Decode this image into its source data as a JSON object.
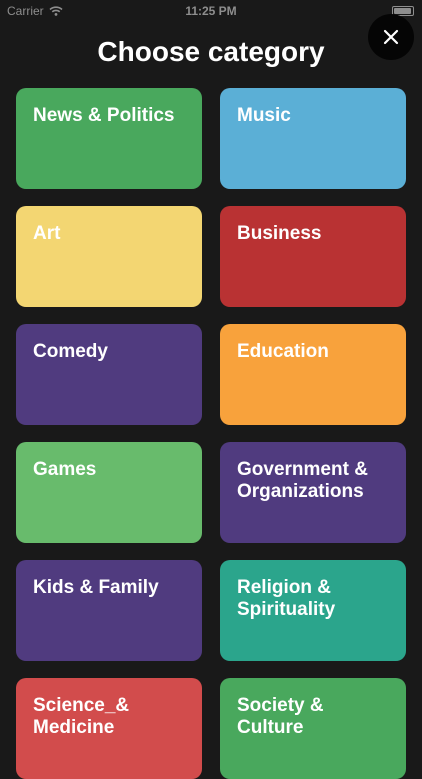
{
  "status_bar": {
    "carrier": "Carrier",
    "time": "11:25 PM"
  },
  "header": {
    "title": "Choose category",
    "close_icon": "close-icon"
  },
  "categories": [
    {
      "label": "News & Politics",
      "color": "#49a85d"
    },
    {
      "label": "Music",
      "color": "#5bafd6"
    },
    {
      "label": "Art",
      "color": "#f3d672"
    },
    {
      "label": "Business",
      "color": "#b93233"
    },
    {
      "label": "Comedy",
      "color": "#503b7f"
    },
    {
      "label": "Education",
      "color": "#f8a23c"
    },
    {
      "label": "Games",
      "color": "#68bb6c"
    },
    {
      "label": "Government & Organizations",
      "color": "#503b7f"
    },
    {
      "label": "Kids & Family",
      "color": "#503b7f"
    },
    {
      "label": "Religion & Spirituality",
      "color": "#2ba58c"
    },
    {
      "label": "Science_& Medicine",
      "color": "#d24c4c"
    },
    {
      "label": "Society & Culture",
      "color": "#49a85d"
    }
  ]
}
